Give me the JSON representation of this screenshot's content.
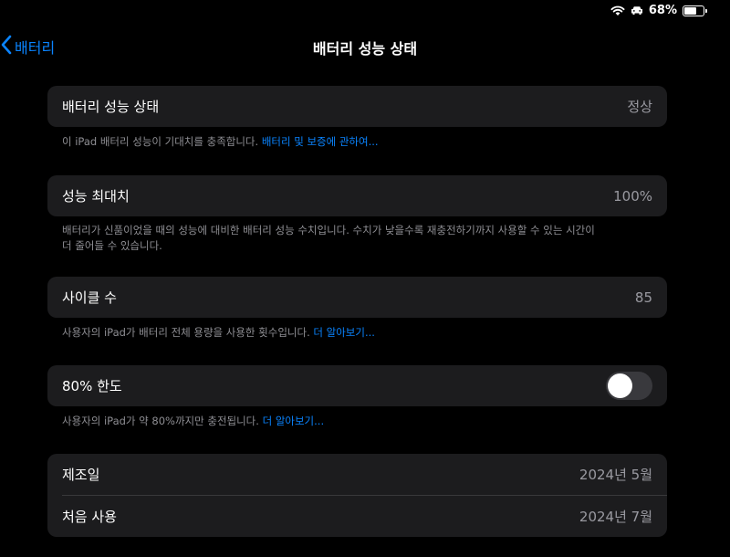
{
  "status": {
    "battery_percent": "68%",
    "battery_level": 0.68
  },
  "nav": {
    "back_label": "배터리",
    "title": "배터리 성능 상태"
  },
  "health": {
    "label": "배터리 성능 상태",
    "value": "정상",
    "note_text": "이 iPad 배터리 성능이 기대치를 충족합니다. ",
    "note_link": "배터리 및 보증에 관하여..."
  },
  "max_capacity": {
    "label": "성능 최대치",
    "value": "100%",
    "note_line1": "배터리가 신품이었을 때의 성능에 대비한 배터리 성능 수치입니다. 수치가 낮을수록 재충전하기까지 사용할 수 있는 시간이",
    "note_line2": "더 줄어들 수 있습니다."
  },
  "cycle_count": {
    "label": "사이클 수",
    "value": "85",
    "note_text": "사용자의 iPad가 배터리 전체 용량을 사용한 횟수입니다. ",
    "note_link": "더 알아보기..."
  },
  "limit": {
    "label": "80% 한도",
    "enabled": false,
    "note_text": "사용자의 iPad가 약 80%까지만 충전됩니다. ",
    "note_link": "더 알아보기..."
  },
  "dates": {
    "manufacture_label": "제조일",
    "manufacture_value": "2024년 5월",
    "first_use_label": "처음 사용",
    "first_use_value": "2024년 7월"
  },
  "colors": {
    "accent": "#0a84ff",
    "card": "#1c1c1e",
    "background": "#000000"
  }
}
